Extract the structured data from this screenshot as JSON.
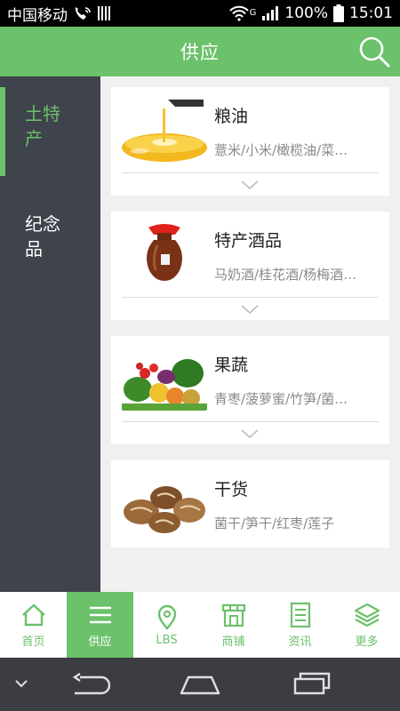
{
  "status_bar": {
    "carrier": "中国移动",
    "signal_type": "G",
    "battery": "100%",
    "time": "15:01"
  },
  "header": {
    "title": "供应"
  },
  "sidebar": {
    "items": [
      {
        "label": "土特产",
        "active": true
      },
      {
        "label": "纪念品",
        "active": false
      }
    ]
  },
  "cards": [
    {
      "title": "粮油",
      "subtitle": "薏米/小米/橄榄油/菜…",
      "image": "cooking-oil-pour"
    },
    {
      "title": "特产酒品",
      "subtitle": "马奶酒/桂花酒/杨梅酒…",
      "image": "wine-jar"
    },
    {
      "title": "果蔬",
      "subtitle": "青枣/菠萝蜜/竹笋/菌…",
      "image": "fruits-vegetables"
    },
    {
      "title": "干货",
      "subtitle": "菌干/笋干/红枣/莲子",
      "image": "dried-mushrooms"
    }
  ],
  "tabbar": {
    "items": [
      {
        "label": "首页",
        "icon": "home-icon",
        "active": false
      },
      {
        "label": "供应",
        "icon": "menu-icon",
        "active": true
      },
      {
        "label": "LBS",
        "icon": "location-pin-icon",
        "active": false
      },
      {
        "label": "商铺",
        "icon": "store-icon",
        "active": false
      },
      {
        "label": "资讯",
        "icon": "document-icon",
        "active": false
      },
      {
        "label": "更多",
        "icon": "layers-icon",
        "active": false
      }
    ]
  },
  "colors": {
    "accent": "#6cc16b",
    "sidebar_bg": "#3f434b",
    "nav_bg": "#3b3d42"
  }
}
